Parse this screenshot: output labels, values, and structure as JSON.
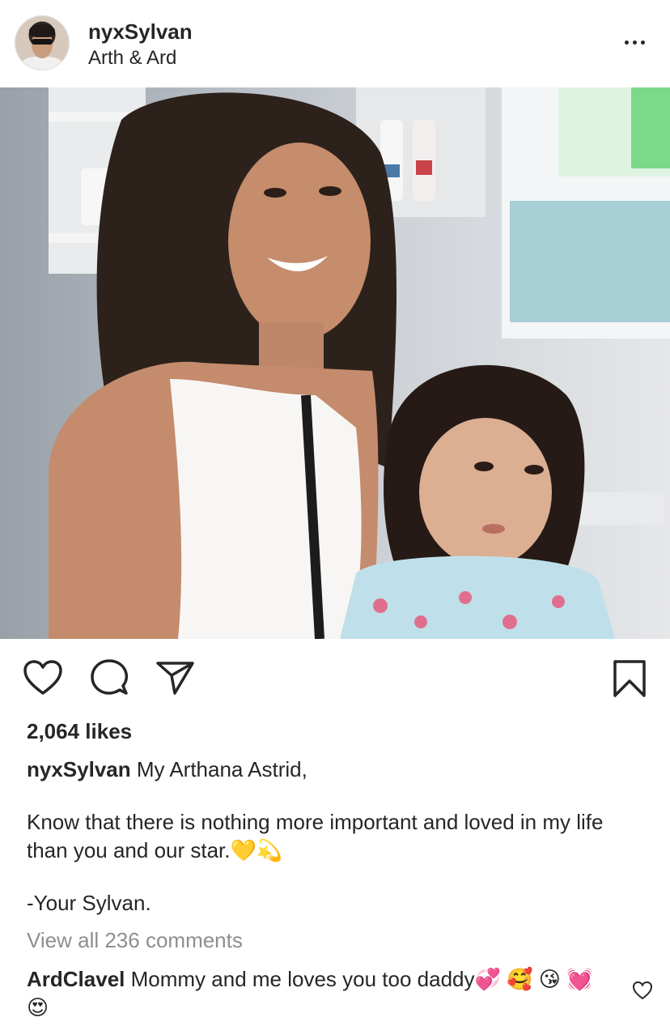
{
  "post": {
    "username": "nyxSylvan",
    "location": "Arth & Ard",
    "more_icon": "more-horizontal-icon",
    "likes_text": "2,064 likes",
    "caption": {
      "username": "nyxSylvan",
      "line1": "My Arthana Astrid,",
      "line2": "Know that there is nothing more important and loved in my life than you and our star.💛💫",
      "line3": "-Your Sylvan."
    },
    "view_all_comments": "View all 236 comments",
    "comment": {
      "username": "ArdClavel",
      "text": "Mommy and me loves you too daddy💞 🥰 😘 💓 😍"
    }
  },
  "icons": {
    "like": "heart-outline-icon",
    "comment": "speech-bubble-icon",
    "share": "paper-plane-icon",
    "save": "bookmark-icon",
    "comment_like": "heart-outline-icon"
  },
  "colors": {
    "text": "#262626",
    "muted": "#8e8e8e",
    "background": "#ffffff"
  }
}
